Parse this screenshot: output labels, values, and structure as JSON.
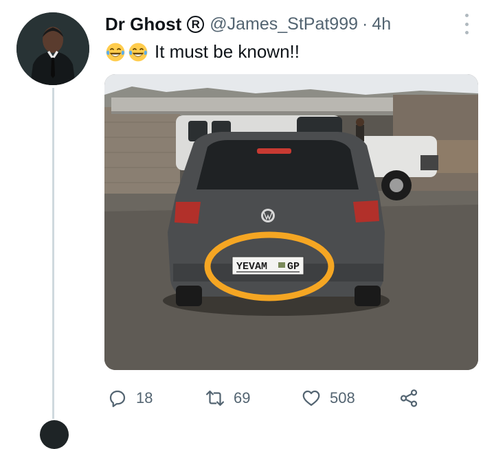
{
  "tweet": {
    "display_name": "Dr Ghost",
    "badge_symbol": "R",
    "handle": "@James_StPat999",
    "separator": "·",
    "time": "4h",
    "emojis": [
      "face-with-tears-of-joy",
      "face-with-tears-of-joy"
    ],
    "text": "It must be known!!",
    "media": {
      "plate_left": "YEVAM",
      "plate_right": "GP",
      "highlight_color": "#f5a623"
    },
    "actions": {
      "replies": "18",
      "retweets": "69",
      "likes": "508"
    }
  },
  "colors": {
    "text_primary": "#0f1419",
    "text_secondary": "#536471",
    "thread_line": "#cfd9de"
  }
}
